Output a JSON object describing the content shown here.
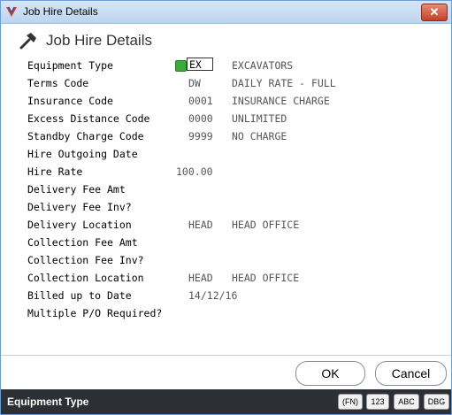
{
  "window": {
    "title": "Job Hire Details",
    "close_symbol": "✕"
  },
  "header": {
    "title": "Job Hire Details"
  },
  "form": {
    "equipment_type": {
      "label": "Equipment Type",
      "value": "EX",
      "description": "EXCAVATORS"
    },
    "terms_code": {
      "label": "Terms Code",
      "code": "DW",
      "description": "DAILY RATE - FULL"
    },
    "insurance_code": {
      "label": "Insurance Code",
      "code": "0001",
      "description": "INSURANCE CHARGE"
    },
    "excess_distance_code": {
      "label": "Excess Distance Code",
      "code": "0000",
      "description": "UNLIMITED"
    },
    "standby_charge_code": {
      "label": "Standby Charge Code",
      "code": "9999",
      "description": "NO CHARGE"
    },
    "hire_outgoing_date": {
      "label": "Hire Outgoing Date"
    },
    "hire_rate": {
      "label": "Hire Rate",
      "value": "100.00"
    },
    "delivery_fee_amt": {
      "label": "Delivery Fee Amt"
    },
    "delivery_fee_inv": {
      "label": "Delivery Fee Inv?"
    },
    "delivery_location": {
      "label": "Delivery Location",
      "code": "HEAD",
      "description": "HEAD OFFICE"
    },
    "collection_fee_amt": {
      "label": "Collection Fee Amt"
    },
    "collection_fee_inv": {
      "label": "Collection Fee Inv?"
    },
    "collection_location": {
      "label": "Collection Location",
      "code": "HEAD",
      "description": "HEAD OFFICE"
    },
    "billed_up_to_date": {
      "label": "Billed up to Date",
      "value": "14/12/16"
    },
    "multiple_po_required": {
      "label": "Multiple P/O Required?"
    }
  },
  "buttons": {
    "ok": "OK",
    "cancel": "Cancel"
  },
  "status": {
    "text": "Equipment Type",
    "badges": [
      "(FN)",
      "123",
      "ABC",
      "DBG"
    ]
  },
  "colors": {
    "statusbar": "#2c2f33",
    "titlebar": "#c8dcf2",
    "close": "#c6402a",
    "lookup": "#3bab3b"
  },
  "icons": {
    "app": "app-logo-icon",
    "header": "hammer-icon",
    "lookup": "lookup-icon",
    "close": "close-icon"
  }
}
